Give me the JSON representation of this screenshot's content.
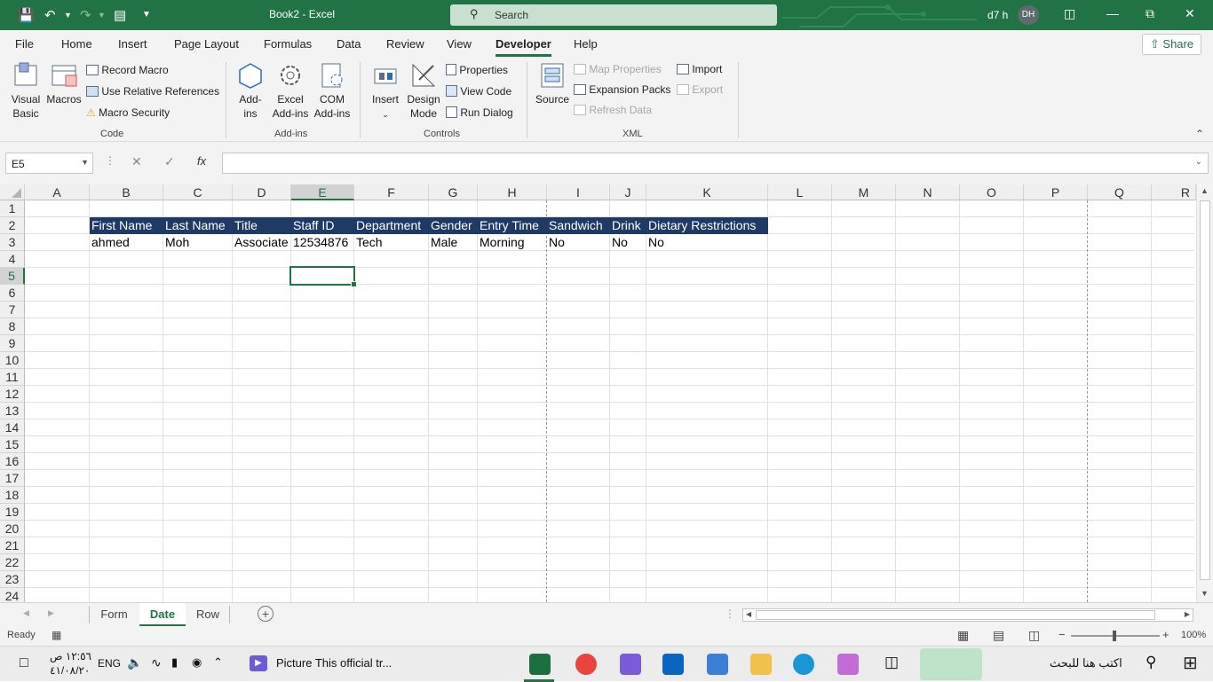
{
  "title_bar": {
    "doc_title": "Book2  -  Excel",
    "search_placeholder": "Search",
    "user_name": "d7 h",
    "user_initials": "DH"
  },
  "menu": [
    "File",
    "Home",
    "Insert",
    "Page Layout",
    "Formulas",
    "Data",
    "Review",
    "View",
    "Developer",
    "Help"
  ],
  "active_menu": "Developer",
  "share_label": "Share",
  "ribbon": {
    "code": {
      "visual_basic": [
        "Visual",
        "Basic"
      ],
      "macros": "Macros",
      "record_macro": "Record Macro",
      "relative_refs": "Use Relative References",
      "macro_security": "Macro Security",
      "label": "Code"
    },
    "addins": {
      "addins": [
        "Add-",
        "ins"
      ],
      "excel_addins": [
        "Excel",
        "Add-ins"
      ],
      "com_addins": [
        "COM",
        "Add-ins"
      ],
      "label": "Add-ins"
    },
    "controls": {
      "insert": "Insert",
      "design_mode": [
        "Design",
        "Mode"
      ],
      "properties": "Properties",
      "view_code": "View Code",
      "run_dialog": "Run Dialog",
      "label": "Controls"
    },
    "xml": {
      "source": "Source",
      "map_properties": "Map Properties",
      "expansion_packs": "Expansion Packs",
      "refresh_data": "Refresh Data",
      "import": "Import",
      "export": "Export",
      "label": "XML"
    }
  },
  "formula_bar": {
    "name_box": "E5",
    "fx": "fx",
    "formula": ""
  },
  "columns": [
    "A",
    "B",
    "C",
    "D",
    "E",
    "F",
    "G",
    "H",
    "I",
    "J",
    "K",
    "L",
    "M",
    "N",
    "O",
    "P",
    "Q",
    "R"
  ],
  "rows": [
    "1",
    "2",
    "3",
    "4",
    "5",
    "6",
    "7",
    "8",
    "9",
    "10",
    "11",
    "12",
    "13",
    "14",
    "15",
    "16",
    "17",
    "18",
    "19",
    "20",
    "21",
    "22",
    "23",
    "24"
  ],
  "selected_cell": {
    "column": "E",
    "row": "5"
  },
  "table": {
    "headers": [
      "First Name",
      "Last Name",
      "Title",
      "Staff ID",
      "Department",
      "Gender",
      "Entry Time",
      "Sandwich",
      "Drink",
      "Dietary Restrictions"
    ],
    "rows": [
      [
        "ahmed",
        "Moh",
        "Associate",
        "12534876",
        "Tech",
        "Male",
        "Morning",
        "No",
        "No",
        "No"
      ]
    ]
  },
  "sheet_tabs": [
    "Form",
    "Date",
    "Row"
  ],
  "active_sheet": "Date",
  "status": {
    "ready": "Ready",
    "zoom": "100%"
  },
  "taskbar": {
    "time": "١٢:٥٦ ص",
    "date": "٤١/٠٨/٢٠",
    "language": "ENG",
    "media_title": "Picture This official tr...",
    "search_placeholder": "اكتب هنا للبحث"
  },
  "colors": {
    "excel_green": "#217346",
    "header_fill": "#1f3a64"
  }
}
